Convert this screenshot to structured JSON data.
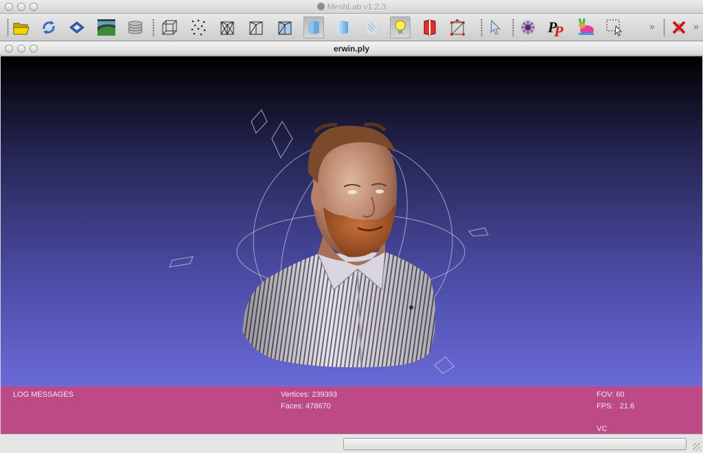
{
  "app": {
    "title": "MeshLab v1.2.3"
  },
  "toolbar": {
    "buttons": [
      {
        "name": "open-icon"
      },
      {
        "name": "reload-icon"
      },
      {
        "name": "save-icon"
      },
      {
        "name": "snapshot-icon"
      },
      {
        "name": "layers-icon"
      },
      {
        "name": "bbox-icon"
      },
      {
        "name": "points-icon"
      },
      {
        "name": "wireframe-icon"
      },
      {
        "name": "hidden-lines-icon"
      },
      {
        "name": "flat-lines-icon"
      },
      {
        "name": "flat-icon"
      },
      {
        "name": "smooth-icon"
      },
      {
        "name": "texture-icon"
      },
      {
        "name": "light-icon"
      },
      {
        "name": "backface-icon"
      },
      {
        "name": "selected-faces-icon"
      },
      {
        "name": "select-vertices-icon"
      },
      {
        "name": "align-icon"
      },
      {
        "name": "paint-icon"
      },
      {
        "name": "color-bunny-icon"
      },
      {
        "name": "select-faces-icon"
      },
      {
        "name": "delete-icon"
      }
    ],
    "overflow_glyph": "»"
  },
  "document": {
    "title": "erwin.ply"
  },
  "log": {
    "header": "LOG MESSAGES",
    "vertices": "Vertices: 239393",
    "faces": "Faces: 478670",
    "fov": "FOV: 60",
    "fps": "FPS:   21.6",
    "mode": "VC"
  },
  "colors": {
    "log_background": "#bd4a86",
    "viewport_top": "#000000",
    "viewport_bottom": "#6a6ad8"
  }
}
